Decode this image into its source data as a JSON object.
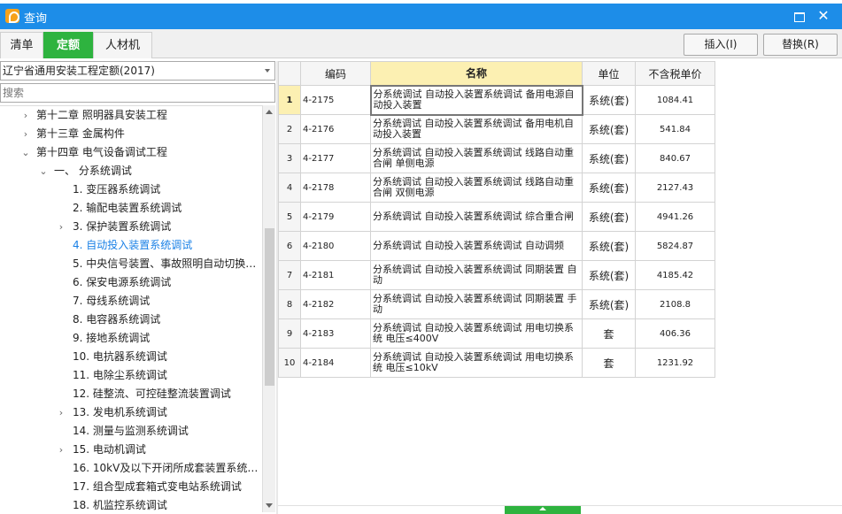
{
  "window": {
    "title": "查询",
    "maximize_label": "",
    "close_label": "✕"
  },
  "tabs": [
    {
      "label": "清单"
    },
    {
      "label": "定额"
    },
    {
      "label": "人材机"
    }
  ],
  "toolbar": {
    "insert_label": "插入(I)",
    "replace_label": "替换(R)"
  },
  "left": {
    "selected_norm": "辽宁省通用安装工程定额(2017)",
    "search_placeholder": "搜索"
  },
  "tree": [
    {
      "label": "第十二章 照明器具安装工程",
      "chev": "›",
      "level": 0
    },
    {
      "label": "第十三章 金属构件",
      "chev": "›",
      "level": 0
    },
    {
      "label": "第十四章 电气设备调试工程",
      "chev": "⌄",
      "level": 0
    },
    {
      "label": "一、 分系统调试",
      "chev": "⌄",
      "level": 1
    },
    {
      "label": "1.  变压器系统调试",
      "chev": "",
      "level": 2
    },
    {
      "label": "2.  输配电装置系统调试",
      "chev": "",
      "level": 2
    },
    {
      "label": "3.  保护装置系统调试",
      "chev": "›",
      "level": 2
    },
    {
      "label": "4.  自动投入装置系统调试",
      "chev": "",
      "level": 2,
      "selected": true
    },
    {
      "label": "5.  中央信号装置、事故照明自动切换…",
      "chev": "",
      "level": 2
    },
    {
      "label": "6.  保安电源系统调试",
      "chev": "",
      "level": 2
    },
    {
      "label": "7.  母线系统调试",
      "chev": "",
      "level": 2
    },
    {
      "label": "8.  电容器系统调试",
      "chev": "",
      "level": 2
    },
    {
      "label": "9.  接地系统调试",
      "chev": "",
      "level": 2
    },
    {
      "label": "10.  电抗器系统调试",
      "chev": "",
      "level": 2
    },
    {
      "label": "11.  电除尘系统调试",
      "chev": "",
      "level": 2
    },
    {
      "label": "12.  硅整流、可控硅整流装置调试",
      "chev": "",
      "level": 2
    },
    {
      "label": "13.  发电机系统调试",
      "chev": "›",
      "level": 2
    },
    {
      "label": "14.  测量与监测系统调试",
      "chev": "",
      "level": 2
    },
    {
      "label": "15.  电动机调试",
      "chev": "›",
      "level": 2
    },
    {
      "label": "16.  10kV及以下开闭所成套装置系统…",
      "chev": "",
      "level": 2
    },
    {
      "label": "17.  组合型成套箱式变电站系统调试",
      "chev": "",
      "level": 2
    },
    {
      "label": "18.  机监控系统调试",
      "chev": "",
      "level": 2
    }
  ],
  "table": {
    "headers": {
      "rownum": "",
      "code": "编码",
      "name": "名称",
      "unit": "单位",
      "price": "不含税单价"
    },
    "rows": [
      {
        "n": "1",
        "code": "4-2175",
        "name": "分系统调试 自动投入装置系统调试 备用电源自动投入装置",
        "unit": "系统(套)",
        "price": "1084.41"
      },
      {
        "n": "2",
        "code": "4-2176",
        "name": "分系统调试 自动投入装置系统调试 备用电机自动投入装置",
        "unit": "系统(套)",
        "price": "541.84"
      },
      {
        "n": "3",
        "code": "4-2177",
        "name": "分系统调试 自动投入装置系统调试 线路自动重合闸 单侧电源",
        "unit": "系统(套)",
        "price": "840.67"
      },
      {
        "n": "4",
        "code": "4-2178",
        "name": "分系统调试 自动投入装置系统调试 线路自动重合闸 双侧电源",
        "unit": "系统(套)",
        "price": "2127.43"
      },
      {
        "n": "5",
        "code": "4-2179",
        "name": "分系统调试 自动投入装置系统调试 综合重合闸",
        "unit": "系统(套)",
        "price": "4941.26"
      },
      {
        "n": "6",
        "code": "4-2180",
        "name": "分系统调试 自动投入装置系统调试 自动调频",
        "unit": "系统(套)",
        "price": "5824.87"
      },
      {
        "n": "7",
        "code": "4-2181",
        "name": "分系统调试 自动投入装置系统调试 同期装置 自动",
        "unit": "系统(套)",
        "price": "4185.42"
      },
      {
        "n": "8",
        "code": "4-2182",
        "name": "分系统调试 自动投入装置系统调试 同期装置 手动",
        "unit": "系统(套)",
        "price": "2108.8"
      },
      {
        "n": "9",
        "code": "4-2183",
        "name": "分系统调试 自动投入装置系统调试 用电切换系统 电压≤400V",
        "unit": "套",
        "price": "406.36"
      },
      {
        "n": "10",
        "code": "4-2184",
        "name": "分系统调试 自动投入装置系统调试 用电切换系统 电压≤10kV",
        "unit": "套",
        "price": "1231.92"
      }
    ]
  }
}
